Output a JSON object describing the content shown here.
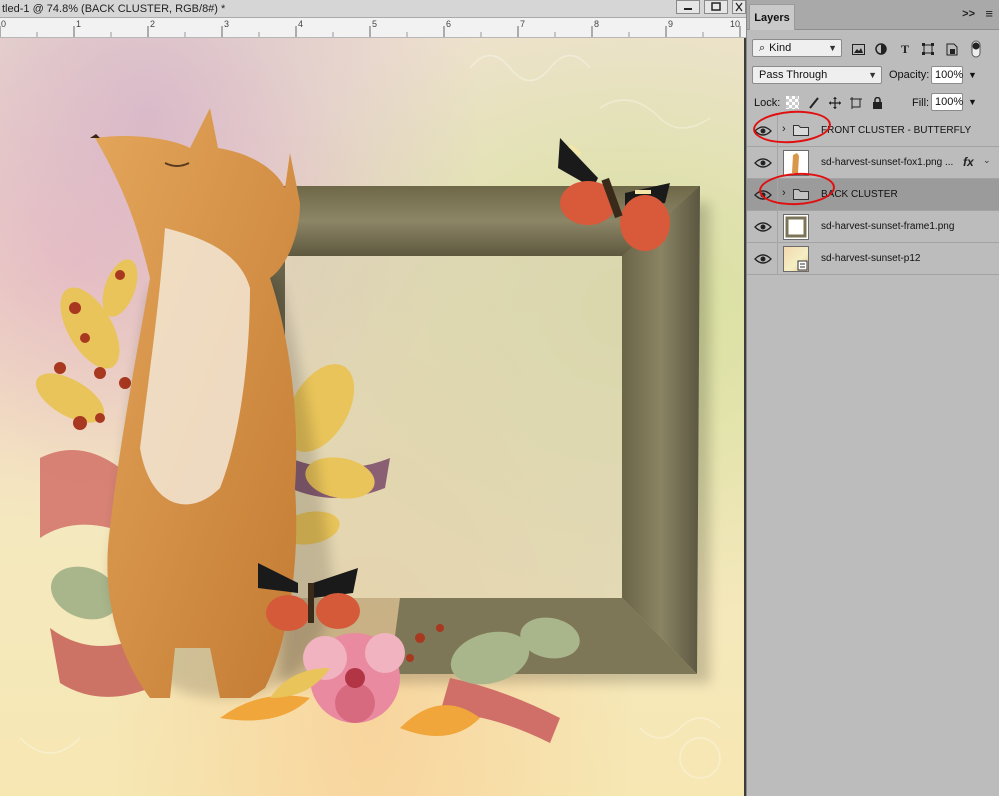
{
  "document": {
    "title": "tled-1 @ 74.8% (BACK CLUSTER, RGB/8#) *",
    "ruler_ticks": [
      "0",
      "1",
      "2",
      "3",
      "4",
      "5",
      "6",
      "7",
      "8",
      "9",
      "10"
    ]
  },
  "panel": {
    "tab_label": "Layers",
    "collapse_label": ">>",
    "filter": {
      "kind_label": "Kind"
    },
    "blend_mode": "Pass Through",
    "opacity_label": "Opacity:",
    "opacity_value": "100%",
    "lock_label": "Lock:",
    "fill_label": "Fill:",
    "fill_value": "100%"
  },
  "layers": [
    {
      "name": "FRONT CLUSTER - BUTTERFLY",
      "type": "group",
      "visible": true,
      "selected": false,
      "highlighted": true
    },
    {
      "name": "sd-harvest-sunset-fox1.png ...",
      "type": "image",
      "visible": true,
      "selected": false,
      "fx": "fx"
    },
    {
      "name": "BACK CLUSTER",
      "type": "group",
      "visible": true,
      "selected": true,
      "highlighted": true
    },
    {
      "name": "sd-harvest-sunset-frame1.png",
      "type": "image",
      "visible": true,
      "selected": false
    },
    {
      "name": "sd-harvest-sunset-p12",
      "type": "smart-object",
      "visible": true,
      "selected": false
    }
  ],
  "colors": {
    "panel_bg": "#bcbcbc",
    "selected_layer": "#9b9b9b",
    "annotation_ring": "#e01010"
  }
}
